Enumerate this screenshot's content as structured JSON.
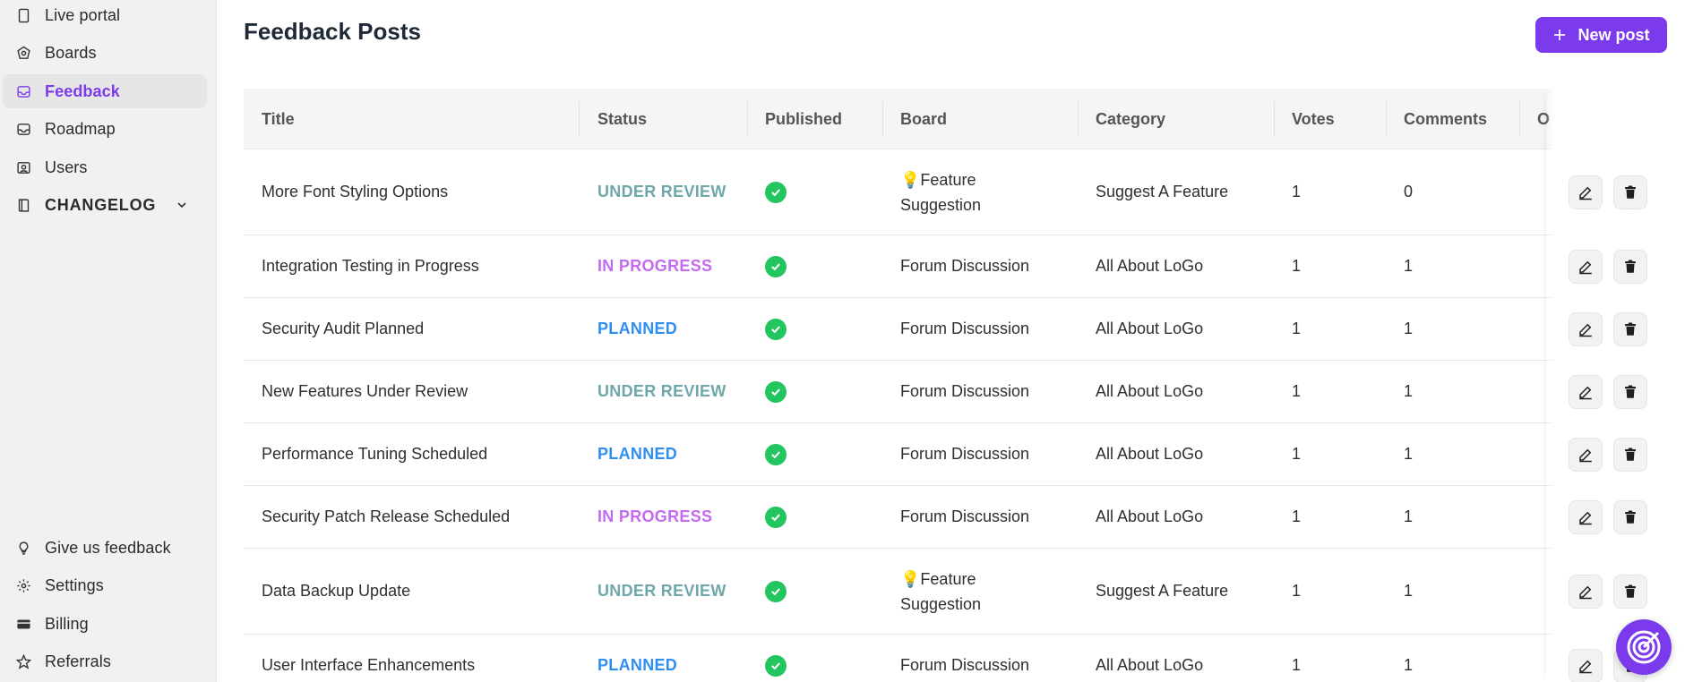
{
  "sidebar": {
    "items": [
      {
        "label": "Live portal",
        "icon": "phone-icon"
      },
      {
        "label": "Boards",
        "icon": "boards-icon"
      },
      {
        "label": "Feedback",
        "icon": "inbox-icon",
        "active": true
      },
      {
        "label": "Roadmap",
        "icon": "roadmap-icon"
      },
      {
        "label": "Users",
        "icon": "users-icon"
      },
      {
        "label": "CHANGELOG",
        "icon": "book-icon"
      }
    ],
    "bottom_items": [
      {
        "label": "Give us feedback",
        "icon": "lightbulb-icon"
      },
      {
        "label": "Settings",
        "icon": "gear-icon"
      },
      {
        "label": "Billing",
        "icon": "card-icon"
      },
      {
        "label": "Referrals",
        "icon": "star-icon"
      }
    ]
  },
  "header": {
    "title": "Feedback Posts",
    "new_post_label": "New post"
  },
  "table": {
    "columns": [
      "Title",
      "Status",
      "Published",
      "Board",
      "Category",
      "Votes",
      "Comments",
      "O"
    ],
    "rows": [
      {
        "title": "More Font Styling Options",
        "status": "UNDER REVIEW",
        "board_emoji": "💡",
        "board": "Feature Suggestion",
        "board_line1": "Feature",
        "board_line2": "Suggestion",
        "category": "Suggest A Feature",
        "votes": "1",
        "comments": "0"
      },
      {
        "title": "Integration Testing in Progress",
        "status": "IN PROGRESS",
        "board_emoji": "",
        "board": "Forum Discussion",
        "board_line1": "Forum Discussion",
        "board_line2": "",
        "category": "All About LoGo",
        "votes": "1",
        "comments": "1"
      },
      {
        "title": "Security Audit Planned",
        "status": "PLANNED",
        "board_emoji": "",
        "board": "Forum Discussion",
        "board_line1": "Forum Discussion",
        "board_line2": "",
        "category": "All About LoGo",
        "votes": "1",
        "comments": "1"
      },
      {
        "title": "New Features Under Review",
        "status": "UNDER REVIEW",
        "board_emoji": "",
        "board": "Forum Discussion",
        "board_line1": "Forum Discussion",
        "board_line2": "",
        "category": "All About LoGo",
        "votes": "1",
        "comments": "1"
      },
      {
        "title": "Performance Tuning Scheduled",
        "status": "PLANNED",
        "board_emoji": "",
        "board": "Forum Discussion",
        "board_line1": "Forum Discussion",
        "board_line2": "",
        "category": "All About LoGo",
        "votes": "1",
        "comments": "1"
      },
      {
        "title": "Security Patch Release Scheduled",
        "status": "IN PROGRESS",
        "board_emoji": "",
        "board": "Forum Discussion",
        "board_line1": "Forum Discussion",
        "board_line2": "",
        "category": "All About LoGo",
        "votes": "1",
        "comments": "1"
      },
      {
        "title": "Data Backup Update",
        "status": "UNDER REVIEW",
        "board_emoji": "💡",
        "board": "Feature Suggestion",
        "board_line1": "Feature",
        "board_line2": "Suggestion",
        "category": "Suggest A Feature",
        "votes": "1",
        "comments": "1"
      },
      {
        "title": "User Interface Enhancements",
        "status": "PLANNED",
        "board_emoji": "",
        "board": "Forum Discussion",
        "board_line1": "Forum Discussion",
        "board_line2": "",
        "category": "All About LoGo",
        "votes": "1",
        "comments": "1"
      }
    ]
  },
  "colors": {
    "accent": "#7c3aed",
    "under_review": "#6fa8a8",
    "in_progress": "#c46bf0",
    "planned": "#2f8ff0",
    "published_check": "#22c55e"
  }
}
